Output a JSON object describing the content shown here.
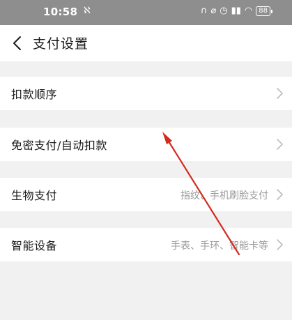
{
  "status_bar": {
    "time": "10:58",
    "app_icon": "ℵ",
    "battery": "88"
  },
  "header": {
    "title": "支付设置",
    "back_icon": "back-icon"
  },
  "rows": [
    {
      "label": "扣款顺序",
      "value": ""
    },
    {
      "label": "免密支付/自动扣款",
      "value": ""
    },
    {
      "label": "生物支付",
      "value": "指纹、手机刷脸支付"
    },
    {
      "label": "智能设备",
      "value": "手表、手环、智能卡等"
    }
  ],
  "colors": {
    "status_bar_bg": "#8e8e8e",
    "page_bg": "#f1f1f1",
    "annotation_arrow": "#d32b1e"
  }
}
